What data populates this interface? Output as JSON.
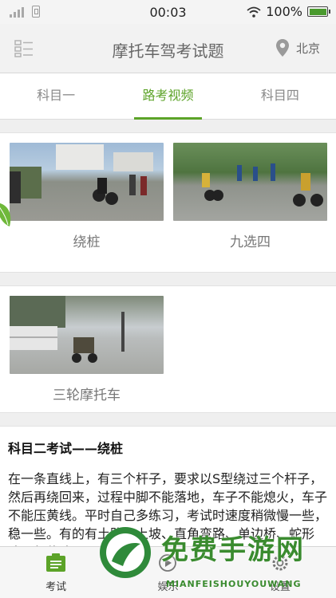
{
  "status_bar": {
    "time": "00:03",
    "battery": "100%"
  },
  "header": {
    "title": "摩托车驾考试题",
    "city": "北京"
  },
  "tabs": [
    {
      "label": "科目一",
      "active": false
    },
    {
      "label": "路考视频",
      "active": true
    },
    {
      "label": "科目四",
      "active": false
    }
  ],
  "videos": [
    {
      "caption": "绕桩"
    },
    {
      "caption": "九选四"
    },
    {
      "caption": "三轮摩托车"
    }
  ],
  "article": {
    "title": "科目二考试——绕桩",
    "body": "在一条直线上，有三个杆子，要求以S型绕过三个杆子，然后再绕回来，过程中脚不能落地，车子不能熄火，车子不能压黄线。平时自己多练习，考试时速度稍微慢一些，稳一些。有的有土路、上坡、直角弯路、单边桥、蛇形路、起伏路"
  },
  "bottom_nav": [
    {
      "label": "考试",
      "icon": "exam-icon",
      "active": true
    },
    {
      "label": "娱乐",
      "icon": "entertainment-icon",
      "active": false
    },
    {
      "label": "设置",
      "icon": "settings-icon",
      "active": false
    }
  ],
  "watermark": {
    "text": "免费手游网",
    "sub": "MIANFEISHOUYOUWANG"
  },
  "colors": {
    "accent": "#5ca328",
    "header_bg": "#f2f2f2"
  }
}
